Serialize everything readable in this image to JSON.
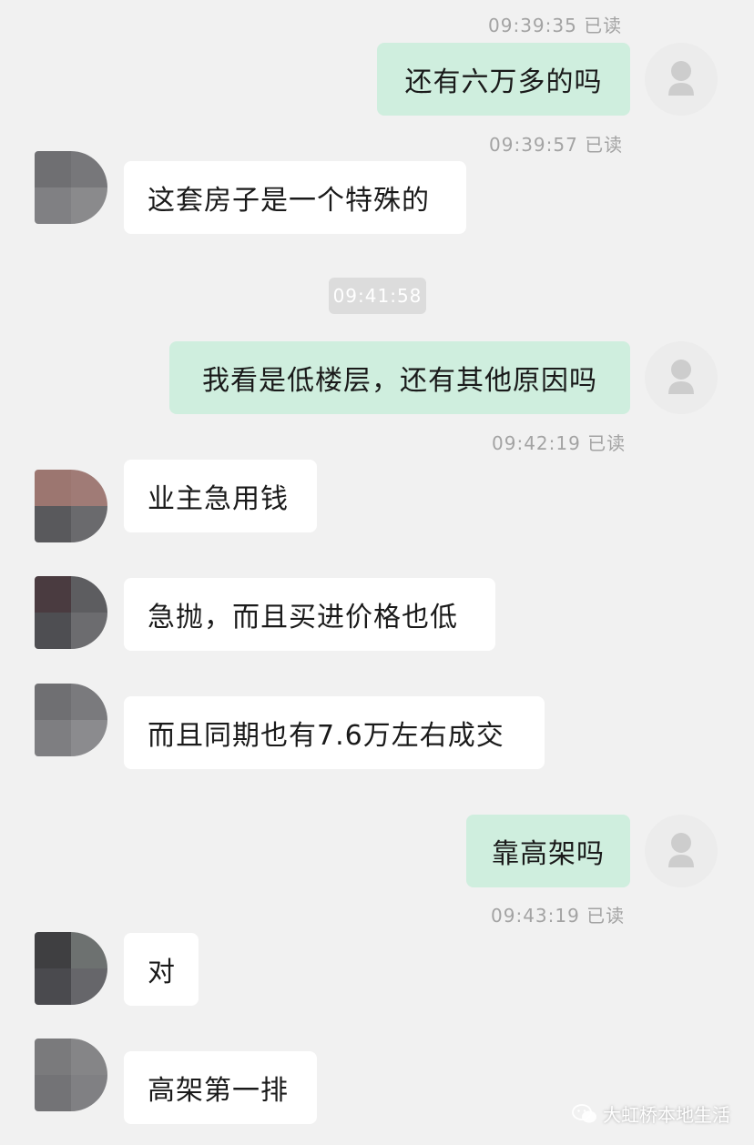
{
  "messages": {
    "m1": {
      "time": "09:39:35 已读",
      "text": "还有六万多的吗"
    },
    "m2": {
      "time": "09:39:57 已读",
      "text": "这套房子是一个特殊的"
    },
    "center_time": "09:41:58",
    "m3": {
      "text": "我看是低楼层，还有其他原因吗",
      "time": "09:42:19 已读"
    },
    "m4": {
      "text": "业主急用钱"
    },
    "m5": {
      "text": "急抛，而且买进价格也低"
    },
    "m6": {
      "text": "而且同期也有7.6万左右成交"
    },
    "m7": {
      "text": "靠高架吗",
      "time": "09:43:19 已读"
    },
    "m8": {
      "text": "对"
    },
    "m9": {
      "text": "高架第一排"
    }
  },
  "watermark": {
    "text": "大虹桥本地生活",
    "icon": "wechat-icon"
  },
  "colors": {
    "background": "#f1f1f1",
    "outgoing_bubble": "#cfeede",
    "incoming_bubble": "#ffffff",
    "timestamp": "#a3a3a3"
  }
}
